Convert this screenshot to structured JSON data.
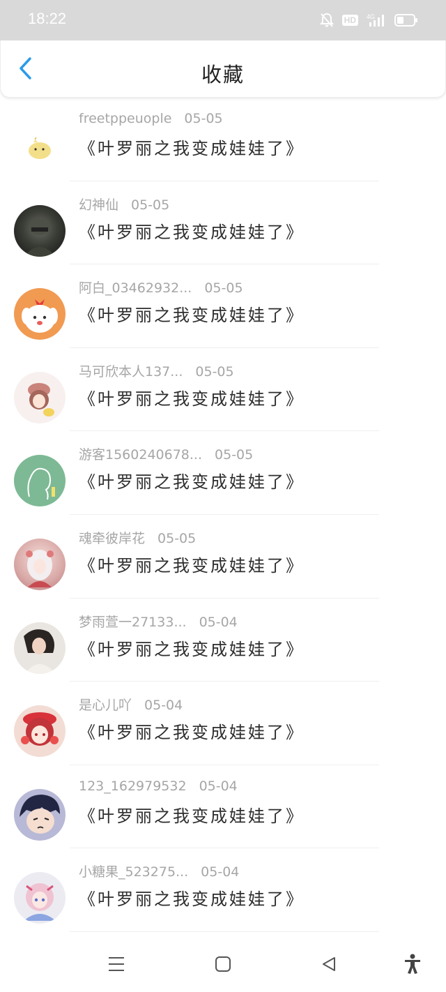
{
  "status_bar": {
    "time": "18:22",
    "icons": [
      "bell-off-icon",
      "hd-icon",
      "signal-4g-icon",
      "battery-icon"
    ],
    "hd_label": "HD"
  },
  "header": {
    "title": "收藏",
    "back_icon": "chevron-left-icon",
    "accent_color": "#2a9bea"
  },
  "favorites": [
    {
      "user": "freetppeuople",
      "date": "05-05",
      "title": "《叶罗丽之我变成娃娃了》"
    },
    {
      "user": "幻神仙",
      "date": "05-05",
      "title": "《叶罗丽之我变成娃娃了》"
    },
    {
      "user": "阿白_03462932...",
      "date": "05-05",
      "title": "《叶罗丽之我变成娃娃了》"
    },
    {
      "user": "马可欣本人137...",
      "date": "05-05",
      "title": "《叶罗丽之我变成娃娃了》"
    },
    {
      "user": "游客1560240678...",
      "date": "05-05",
      "title": "《叶罗丽之我变成娃娃了》"
    },
    {
      "user": "魂牵彼岸花",
      "date": "05-05",
      "title": "《叶罗丽之我变成娃娃了》"
    },
    {
      "user": "梦雨萱一27133...",
      "date": "05-04",
      "title": "《叶罗丽之我变成娃娃了》"
    },
    {
      "user": "是心儿吖",
      "date": "05-04",
      "title": "《叶罗丽之我变成娃娃了》"
    },
    {
      "user": "123_162979532",
      "date": "05-04",
      "title": "《叶罗丽之我变成娃娃了》"
    },
    {
      "user": "小糖果_523275...",
      "date": "05-04",
      "title": "《叶罗丽之我变成娃娃了》"
    }
  ],
  "nav_bar": {
    "icons": [
      "menu-icon",
      "home-square-icon",
      "back-triangle-icon",
      "accessibility-icon"
    ]
  }
}
